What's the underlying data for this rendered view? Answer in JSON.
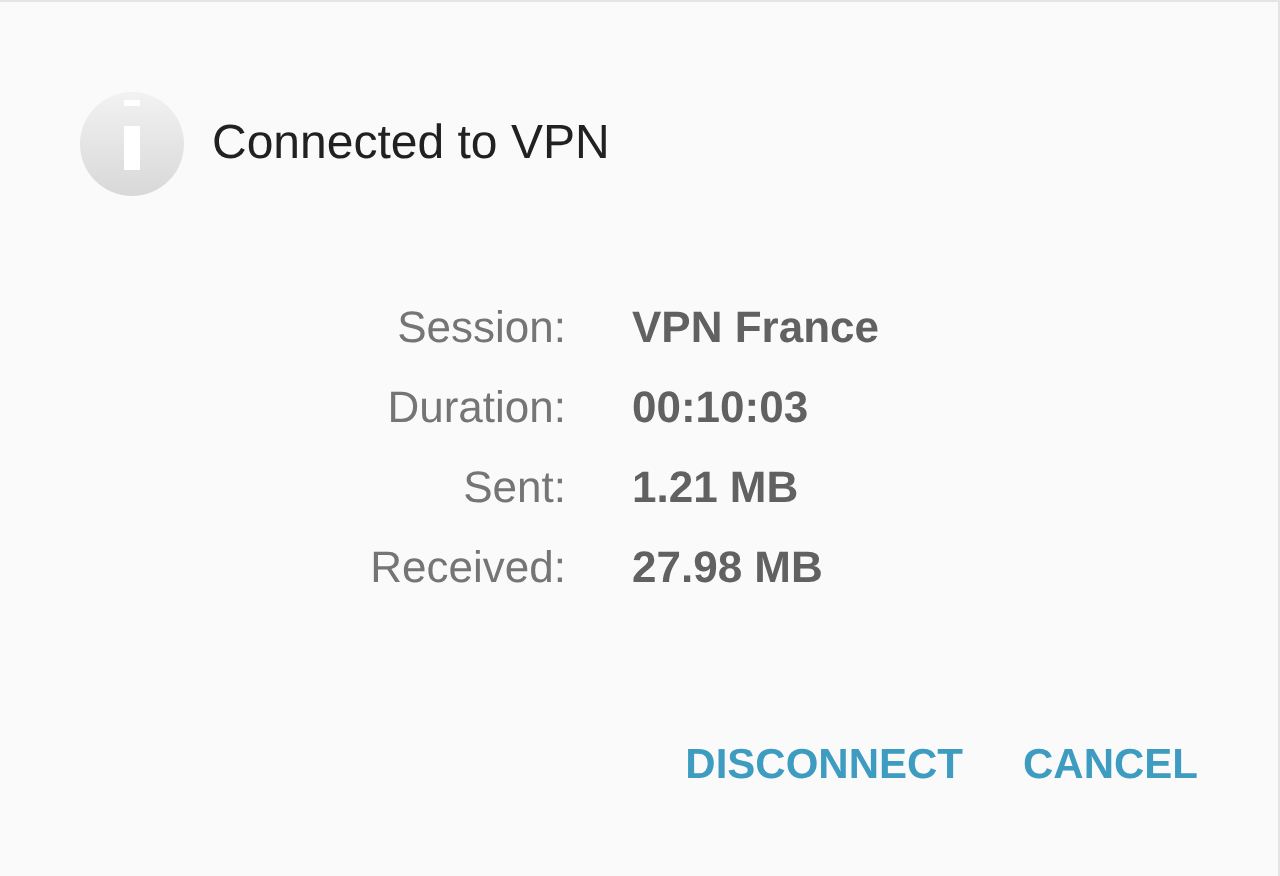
{
  "dialog": {
    "title": "Connected to VPN",
    "details": [
      {
        "label": "Session:",
        "value": "VPN France"
      },
      {
        "label": "Duration:",
        "value": "00:10:03"
      },
      {
        "label": "Sent:",
        "value": "1.21 MB"
      },
      {
        "label": "Received:",
        "value": "27.98 MB"
      }
    ],
    "buttons": [
      "DISCONNECT",
      "CANCEL"
    ]
  }
}
